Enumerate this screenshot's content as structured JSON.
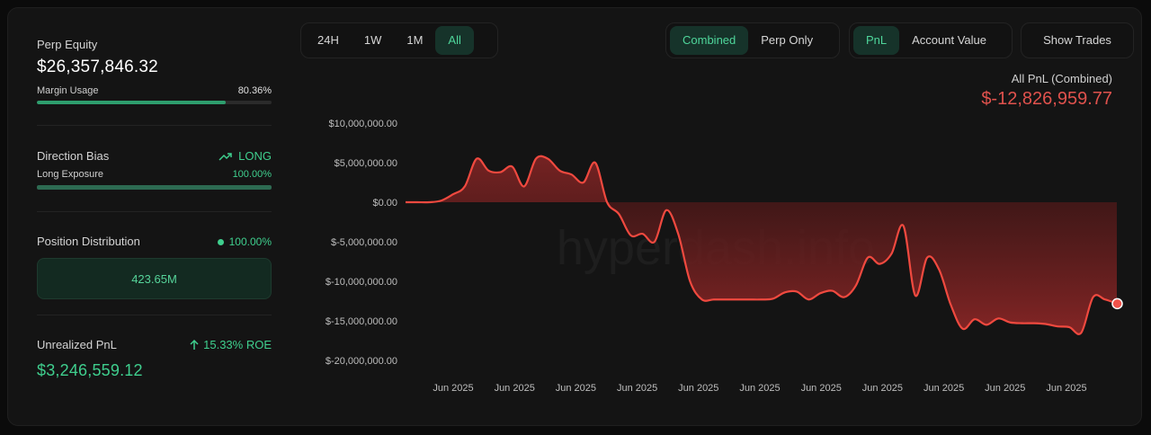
{
  "left": {
    "equity": {
      "label": "Perp Equity",
      "value": "$26,357,846.32"
    },
    "margin": {
      "label": "Margin Usage",
      "value": "80.36%",
      "fraction": 0.8036
    },
    "bias": {
      "label": "Direction Bias",
      "value": "LONG",
      "exposure_label": "Long Exposure",
      "exposure_value": "100.00%",
      "fraction": 1.0
    },
    "distribution": {
      "label": "Position Distribution",
      "value": "100.00%",
      "box_value": "423.65M"
    },
    "unrealized": {
      "label": "Unrealized PnL",
      "roe": "15.33% ROE",
      "value": "$3,246,559.12"
    }
  },
  "toolbar": {
    "ranges": [
      "24H",
      "1W",
      "1M",
      "All"
    ],
    "active_range": "All",
    "modes": [
      "Combined",
      "Perp Only"
    ],
    "active_mode": "Combined",
    "metrics": [
      "PnL",
      "Account Value"
    ],
    "active_metric": "PnL",
    "show_trades": "Show Trades"
  },
  "pnl": {
    "title": "All PnL (Combined)",
    "value": "$-12,826,959.77"
  },
  "watermark": "hyperdash.info",
  "colors": {
    "accent": "#3fcf8e",
    "negative": "#e0524d",
    "line": "#f0493f",
    "background": "#141414"
  },
  "chart_data": {
    "type": "area",
    "ylim": [
      -20000000,
      10000000
    ],
    "y_ticks": [
      "$10,000,000.00",
      "$5,000,000.00",
      "$0.00",
      "$-5,000,000.00",
      "$-10,000,000.00",
      "$-15,000,000.00",
      "$-20,000,000.00"
    ],
    "x_ticks": [
      "Jun 2025",
      "Jun 2025",
      "Jun 2025",
      "Jun 2025",
      "Jun 2025",
      "Jun 2025",
      "Jun 2025",
      "Jun 2025",
      "Jun 2025",
      "Jun 2025",
      "Jun 2025"
    ],
    "series": [
      {
        "values": [
          0,
          0,
          0,
          200000,
          1000000,
          2000000,
          5500000,
          4000000,
          3800000,
          4500000,
          2000000,
          5500000,
          5500000,
          4000000,
          3500000,
          2500000,
          5000000,
          0,
          -1500000,
          -4200000,
          -4000000,
          -5000000,
          -1000000,
          -4000000,
          -10000000,
          -12300000,
          -12300000,
          -12300000,
          -12300000,
          -12300000,
          -12300000,
          -12200000,
          -11400000,
          -11300000,
          -12300000,
          -11500000,
          -11200000,
          -12000000,
          -10500000,
          -7000000,
          -7800000,
          -6500000,
          -3000000,
          -11800000,
          -7000000,
          -8500000,
          -13000000,
          -16000000,
          -14800000,
          -15500000,
          -14700000,
          -15200000,
          -15300000,
          -15300000,
          -15400000,
          -15700000,
          -15800000,
          -16500000,
          -12000000,
          -12300000,
          -12800000
        ],
        "last_value": -12826959.77
      }
    ]
  }
}
